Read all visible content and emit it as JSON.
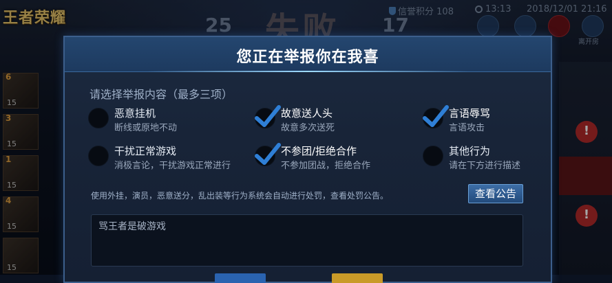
{
  "game": {
    "logo": "王者荣耀",
    "score_left": "25",
    "result": "失败",
    "score_right": "17",
    "credit_label": "信誉积分",
    "credit_value": "108",
    "time": "13:13",
    "date": "2018/12/01 21:16",
    "top_button_label": "离开房"
  },
  "players": [
    {
      "num": "6",
      "level": "15"
    },
    {
      "num": "3",
      "level": "15"
    },
    {
      "num": "1",
      "level": "15"
    },
    {
      "num": "4",
      "level": "15"
    },
    {
      "num": "",
      "level": "15"
    }
  ],
  "dialog": {
    "title": "您正在举报你在我喜",
    "prompt": "请选择举报内容（最多三项）",
    "options": [
      {
        "title": "恶意挂机",
        "subtitle": "断线或原地不动",
        "checked": false
      },
      {
        "title": "故意送人头",
        "subtitle": "故意多次送死",
        "checked": true
      },
      {
        "title": "言语辱骂",
        "subtitle": "言语攻击",
        "checked": true
      },
      {
        "title": "干扰正常游戏",
        "subtitle": "消极言论，干扰游戏正常进行",
        "checked": false
      },
      {
        "title": "不参团/拒绝合作",
        "subtitle": "不参加团战，拒绝合作",
        "checked": true
      },
      {
        "title": "其他行为",
        "subtitle": "请在下方进行描述",
        "checked": false
      }
    ],
    "notice": "使用外挂，演员，恶意送分，乱出装等行为系统会自动进行处罚，查看处罚公告。",
    "notice_button": "查看公告",
    "description": "骂王者是破游戏"
  },
  "colors": {
    "accent": "#3c5f8c",
    "check": "#2f7fd6"
  }
}
